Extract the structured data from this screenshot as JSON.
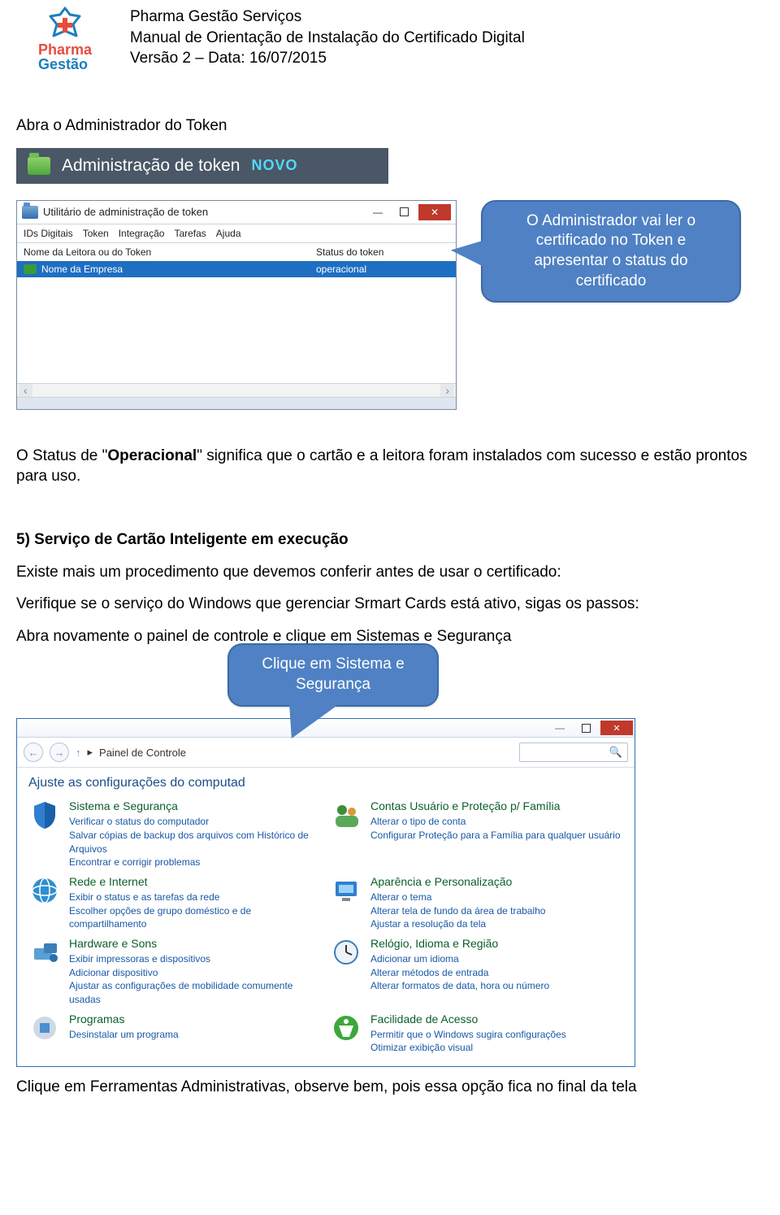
{
  "header": {
    "line1": "Pharma Gestão Serviços",
    "line2": "Manual de Orientação de Instalação do Certificado Digital",
    "line3": "Versão 2 – Data: 16/07/2015",
    "logo_top": "Pharma",
    "logo_bottom": "Gestão"
  },
  "intro": "Abra o Administrador do Token",
  "token_admin": {
    "title": "Administração de token",
    "novo": "NOVO"
  },
  "token_window": {
    "title": "Utilitário de administração de token",
    "menu": [
      "IDs Digitais",
      "Token",
      "Integração",
      "Tarefas",
      "Ajuda"
    ],
    "col1": "Nome da Leitora ou do Token",
    "col2": "Status do token",
    "row_name": "Nome da Empresa",
    "row_status": "operacional"
  },
  "callout1": "O Administrador vai ler o certificado no Token e apresentar o status do certificado",
  "status_text_pre": "O Status de \"",
  "status_text_bold": "Operacional",
  "status_text_post": "\" significa que o cartão e a leitora foram instalados com sucesso e estão prontos para uso.",
  "section5": {
    "title": "5)  Serviço de Cartão Inteligente em execução",
    "line1": "Existe mais um procedimento que devemos conferir antes de usar o certificado:",
    "line2": "Verifique se o serviço do Windows que gerenciar Srmart Cards está ativo, sigas os passos:",
    "line3": "Abra novamente o painel de controle e clique em Sistemas e Segurança"
  },
  "callout2": "Clique em Sistema e Segurança",
  "control_panel": {
    "crumb": "Painel de Controle",
    "heading": "Ajuste as configurações do computad",
    "items": [
      {
        "cat": "Sistema e Segurança",
        "links": [
          "Verificar o status do computador",
          "Salvar cópias de backup dos arquivos com Histórico de Arquivos",
          "Encontrar e corrigir problemas"
        ]
      },
      {
        "cat": "Contas Usuário e Proteção p/ Família",
        "links": [
          "Alterar o tipo de conta",
          "Configurar Proteção para a Família para qualquer usuário"
        ]
      },
      {
        "cat": "Rede e Internet",
        "links": [
          "Exibir o status e as tarefas da rede",
          "Escolher opções de grupo doméstico e de compartilhamento"
        ]
      },
      {
        "cat": "Aparência e Personalização",
        "links": [
          "Alterar o tema",
          "Alterar tela de fundo da área de trabalho",
          "Ajustar a resolução da tela"
        ]
      },
      {
        "cat": "Hardware e Sons",
        "links": [
          "Exibir impressoras e dispositivos",
          "Adicionar dispositivo",
          "Ajustar as configurações de mobilidade comumente usadas"
        ]
      },
      {
        "cat": "Relógio, Idioma e Região",
        "links": [
          "Adicionar um idioma",
          "Alterar métodos de entrada",
          "Alterar formatos de data, hora ou número"
        ]
      },
      {
        "cat": "Programas",
        "links": [
          "Desinstalar um programa"
        ]
      },
      {
        "cat": "Facilidade de Acesso",
        "links": [
          "Permitir que o Windows sugira configurações",
          "Otimizar exibição visual"
        ]
      }
    ]
  },
  "footer": "Clique em Ferramentas Administrativas, observe bem, pois essa opção fica no final da tela"
}
